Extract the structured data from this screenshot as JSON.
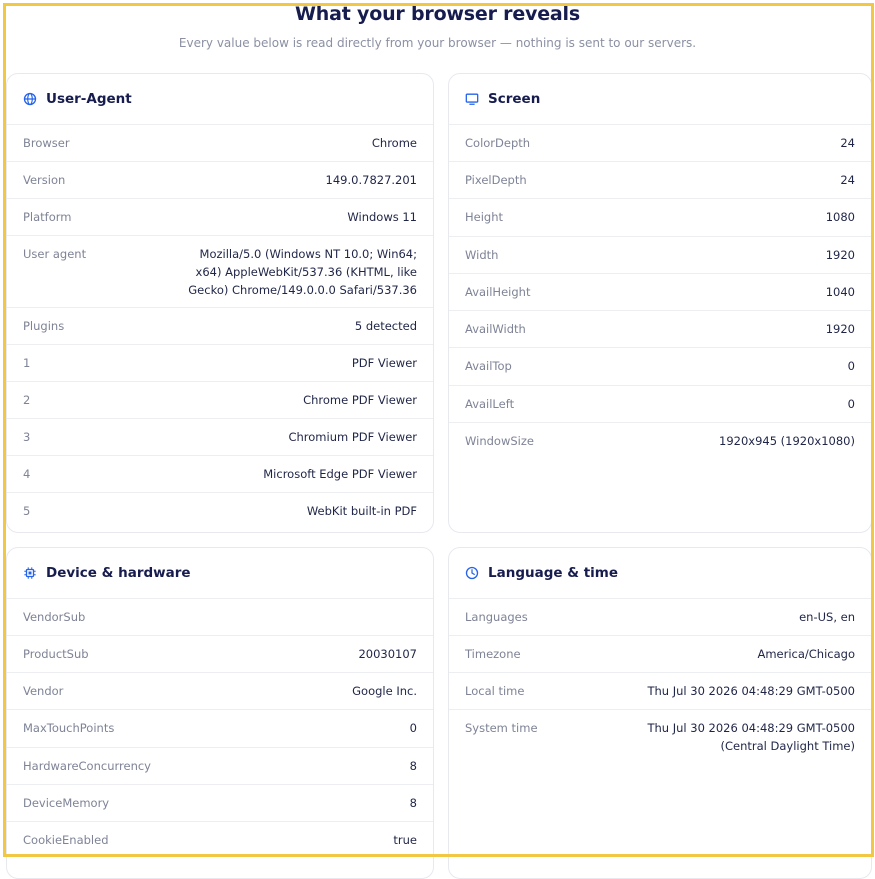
{
  "header": {
    "title": "What your browser reveals",
    "subtitle": "Every value below is read directly from your browser — nothing is sent to our servers."
  },
  "user_agent_card": {
    "title": "User-Agent",
    "icon": "globe-icon",
    "rows": [
      {
        "label": "Browser",
        "value": "Chrome"
      },
      {
        "label": "Version",
        "value": "149.0.7827.201"
      },
      {
        "label": "Platform",
        "value": "Windows 11"
      },
      {
        "label": "User agent",
        "value": "Mozilla/5.0 (Windows NT 10.0; Win64; x64) AppleWebKit/537.36 (KHTML, like Gecko) Chrome/149.0.0.0 Safari/537.36"
      },
      {
        "label": "Plugins",
        "value": "5 detected"
      },
      {
        "label": "1",
        "value": "PDF Viewer"
      },
      {
        "label": "2",
        "value": "Chrome PDF Viewer"
      },
      {
        "label": "3",
        "value": "Chromium PDF Viewer"
      },
      {
        "label": "4",
        "value": "Microsoft Edge PDF Viewer"
      },
      {
        "label": "5",
        "value": "WebKit built-in PDF"
      }
    ]
  },
  "screen_card": {
    "title": "Screen",
    "icon": "monitor-icon",
    "rows": [
      {
        "label": "ColorDepth",
        "value": "24"
      },
      {
        "label": "PixelDepth",
        "value": "24"
      },
      {
        "label": "Height",
        "value": "1080"
      },
      {
        "label": "Width",
        "value": "1920"
      },
      {
        "label": "AvailHeight",
        "value": "1040"
      },
      {
        "label": "AvailWidth",
        "value": "1920"
      },
      {
        "label": "AvailTop",
        "value": "0"
      },
      {
        "label": "AvailLeft",
        "value": "0"
      },
      {
        "label": "WindowSize",
        "value": "1920x945 (1920x1080)"
      }
    ]
  },
  "device_card": {
    "title": "Device & hardware",
    "icon": "chip-icon",
    "rows": [
      {
        "label": "VendorSub",
        "value": ""
      },
      {
        "label": "ProductSub",
        "value": "20030107"
      },
      {
        "label": "Vendor",
        "value": "Google Inc."
      },
      {
        "label": "MaxTouchPoints",
        "value": "0"
      },
      {
        "label": "HardwareConcurrency",
        "value": "8"
      },
      {
        "label": "DeviceMemory",
        "value": "8"
      },
      {
        "label": "CookieEnabled",
        "value": "true"
      }
    ]
  },
  "language_card": {
    "title": "Language & time",
    "icon": "clock-icon",
    "rows": [
      {
        "label": "Languages",
        "value": "en-US, en"
      },
      {
        "label": "Timezone",
        "value": "America/Chicago"
      },
      {
        "label": "Local time",
        "value": "Thu Jul 30 2026 04:48:29 GMT-0500"
      },
      {
        "label": "System time",
        "value": "Thu Jul 30 2026 04:48:29 GMT-0500 (Central Daylight Time)"
      }
    ]
  },
  "colors": {
    "accent": "#2563eb",
    "frame": "#f2c744",
    "title": "#161c4d"
  }
}
